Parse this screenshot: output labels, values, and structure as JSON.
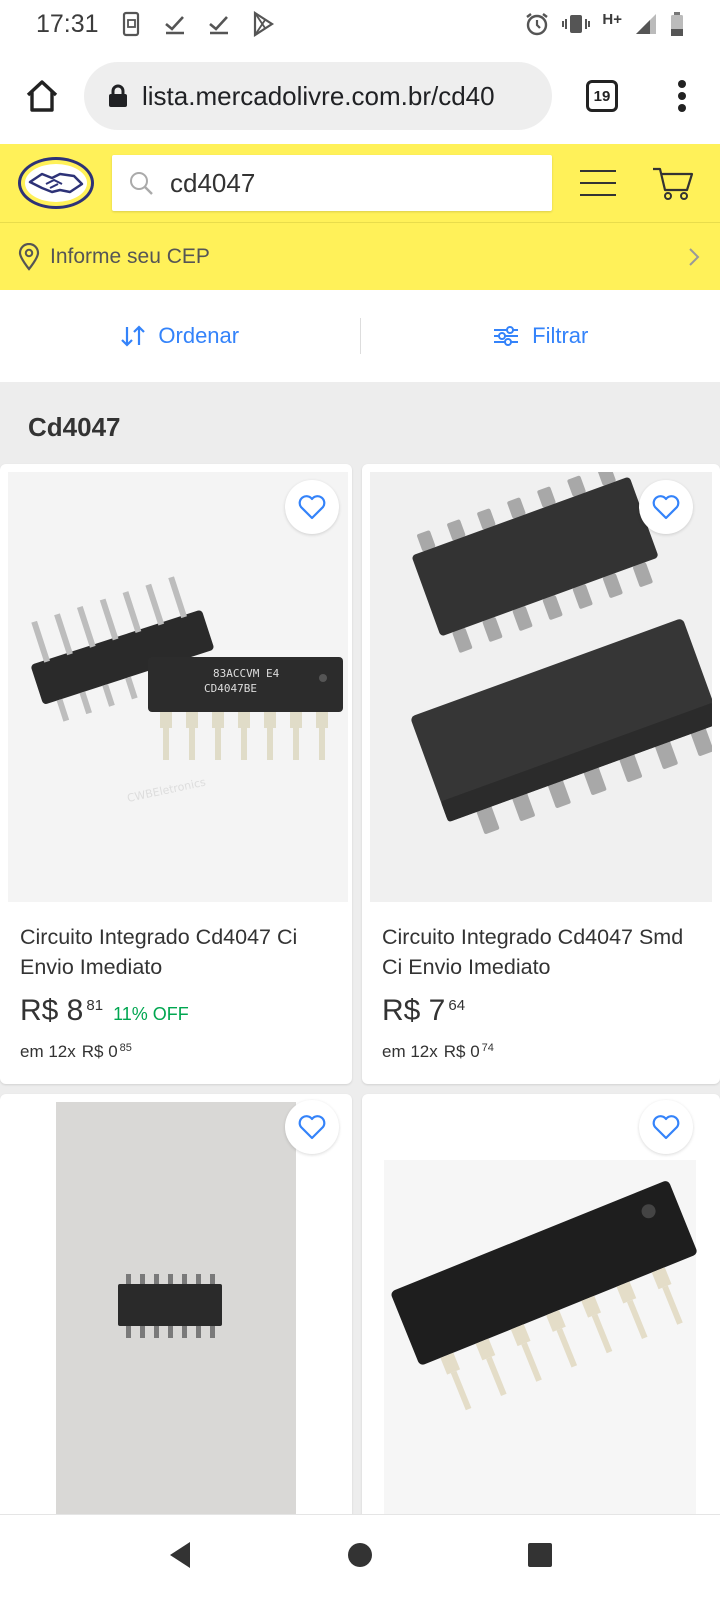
{
  "status_bar": {
    "time": "17:31",
    "network": "H+"
  },
  "browser": {
    "url": "lista.mercadolivre.com.br/cd40",
    "tab_count": "19"
  },
  "header": {
    "search_value": "cd4047",
    "cep_label": "Informe seu CEP"
  },
  "toolbar": {
    "sort_label": "Ordenar",
    "filter_label": "Filtrar"
  },
  "section_title": "Cd4047",
  "products": [
    {
      "title": "Circuito Integrado Cd4047 Ci Envio Imediato",
      "price": "R$ 8",
      "cents": "81",
      "discount": "11% OFF",
      "installments": "em 12x",
      "inst_price": "R$ 0",
      "inst_cents": "85",
      "watermark": "CWBEletronics"
    },
    {
      "title": "Circuito Integrado Cd4047 Smd Ci Envio Imediato",
      "price": "R$ 7",
      "cents": "64",
      "discount": "",
      "installments": "em 12x",
      "inst_price": "R$ 0",
      "inst_cents": "74"
    },
    {
      "title": "",
      "price": "",
      "cents": ""
    },
    {
      "title": "",
      "price": "",
      "cents": ""
    }
  ],
  "colors": {
    "brand_yellow": "#fff159",
    "link_blue": "#3483fa",
    "discount_green": "#00a650"
  }
}
